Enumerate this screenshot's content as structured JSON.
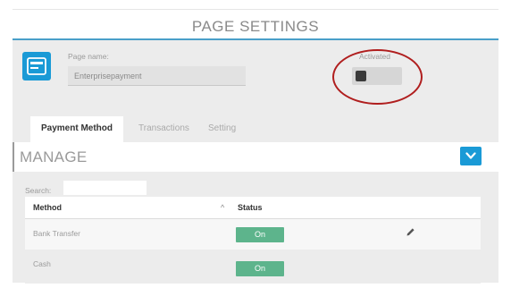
{
  "header": {
    "title": "PAGE SETTINGS"
  },
  "page": {
    "name_label": "Page name:",
    "name_value": "Enterprisepayment",
    "activated_label": "Activated",
    "activated": false
  },
  "tabs": [
    {
      "label": "Payment Method",
      "active": true
    },
    {
      "label": "Transactions",
      "active": false
    },
    {
      "label": "Setting",
      "active": false
    }
  ],
  "manage": {
    "title": "MANAGE",
    "collapse_icon": "chevron-down-icon"
  },
  "search": {
    "label": "Search:",
    "value": ""
  },
  "table": {
    "columns": [
      "Method",
      "Status"
    ],
    "sort_indicator": "^",
    "rows": [
      {
        "method": "Bank Transfer",
        "status": "On"
      },
      {
        "method": "Cash",
        "status": "On"
      }
    ]
  },
  "colors": {
    "accent": "#1a9ad6",
    "status_on": "#5db48c",
    "highlight": "#b01e1e"
  }
}
